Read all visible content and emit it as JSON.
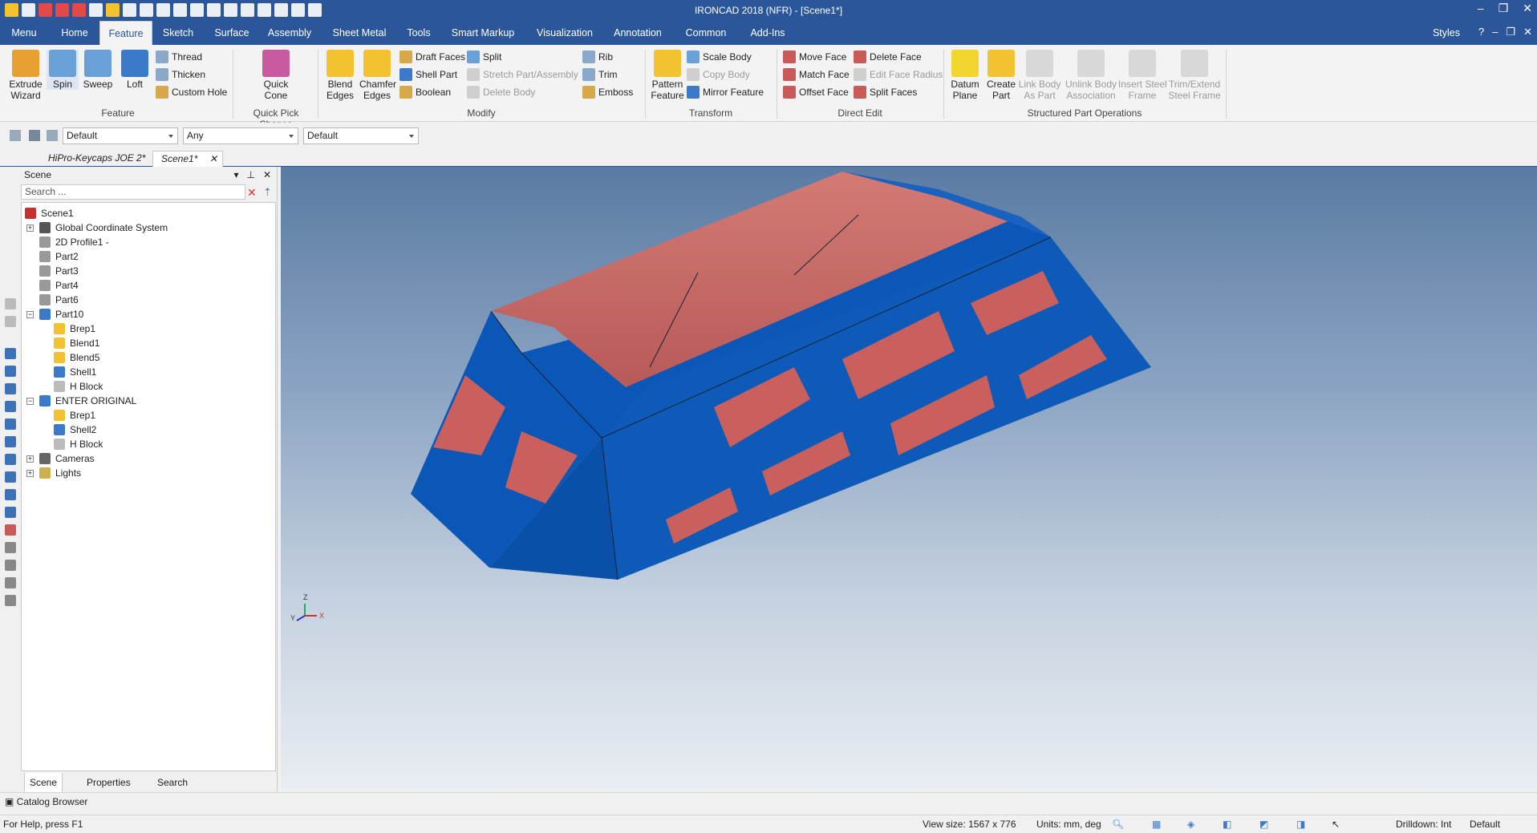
{
  "window": {
    "title": "IRONCAD 2018 (NFR) - [Scene1*]"
  },
  "menu_tabs": [
    "Menu",
    "Home",
    "Feature",
    "Sketch",
    "Surface",
    "Assembly",
    "Sheet Metal",
    "Tools",
    "Smart Markup",
    "Visualization",
    "Annotation",
    "Common",
    "Add-Ins"
  ],
  "active_tab": "Feature",
  "styles_label": "Styles",
  "ribbon": {
    "feature": {
      "extrude": "Extrude\nWizard",
      "spin": "Spin",
      "sweep": "Sweep",
      "loft": "Loft",
      "thread": "Thread",
      "thicken": "Thicken",
      "custom_hole": "Custom Hole",
      "group": "Feature"
    },
    "quick_pick": {
      "quick_cone": "Quick\nCone",
      "group": "Quick Pick Shapes"
    },
    "modify": {
      "blend_edges": "Blend\nEdges",
      "chamfer_edges": "Chamfer\nEdges",
      "draft_faces": "Draft Faces",
      "shell_part": "Shell Part",
      "boolean": "Boolean",
      "split": "Split",
      "stretch": "Stretch Part/Assembly",
      "delete_body": "Delete Body",
      "rib": "Rib",
      "trim": "Trim",
      "emboss": "Emboss",
      "group": "Modify"
    },
    "transform": {
      "pattern": "Pattern\nFeature",
      "scale_body": "Scale Body",
      "copy_body": "Copy Body",
      "mirror": "Mirror Feature",
      "group": "Transform"
    },
    "direct_edit": {
      "move_face": "Move Face",
      "match_face": "Match Face",
      "offset_face": "Offset Face",
      "delete_face": "Delete Face",
      "edit_face_radius": "Edit Face Radius",
      "split_faces": "Split Faces",
      "group": "Direct Edit"
    },
    "structured": {
      "datum_plane": "Datum\nPlane",
      "create_part": "Create\nPart",
      "link_body": "Link Body\nAs Part",
      "unlink_body": "Unlink Body\nAssociation",
      "insert_steel": "Insert Steel\nFrame",
      "trim_steel": "Trim/Extend\nSteel Frame",
      "group": "Structured Part Operations"
    }
  },
  "toolbar": {
    "combo1": "Default",
    "combo2": "Any",
    "combo3": "Default"
  },
  "doc_tabs": [
    {
      "label": "HiPro-Keycaps JOE 2*"
    },
    {
      "label": "Scene1*",
      "close": "✕"
    }
  ],
  "scene_panel": {
    "title": "Scene",
    "search_placeholder": "Search ...",
    "tree": [
      {
        "label": "Scene1",
        "depth": 0
      },
      {
        "label": "Global Coordinate System",
        "depth": 1
      },
      {
        "label": "2D Profile1 -",
        "depth": 1
      },
      {
        "label": "Part2",
        "depth": 1
      },
      {
        "label": "Part3",
        "depth": 1
      },
      {
        "label": "Part4",
        "depth": 1
      },
      {
        "label": "Part6",
        "depth": 1
      },
      {
        "label": "Part10",
        "depth": 1
      },
      {
        "label": "Brep1",
        "depth": 2
      },
      {
        "label": "Blend1",
        "depth": 2
      },
      {
        "label": "Blend5",
        "depth": 2
      },
      {
        "label": "Shell1",
        "depth": 2
      },
      {
        "label": "H Block",
        "depth": 2
      },
      {
        "label": "ENTER ORIGINAL",
        "depth": 1
      },
      {
        "label": "Brep1",
        "depth": 2
      },
      {
        "label": "Shell2",
        "depth": 2
      },
      {
        "label": "H Block",
        "depth": 2
      },
      {
        "label": "Cameras",
        "depth": 1
      },
      {
        "label": "Lights",
        "depth": 1
      }
    ],
    "tabs": [
      "Scene",
      "Properties",
      "Search"
    ]
  },
  "catalog_label": "Catalog Browser",
  "status": {
    "help": "For Help, press F1",
    "view_size": "View size: 1567 x 776",
    "units": "Units: mm, deg",
    "drilldown": "Drilldown: Int",
    "default": "Default"
  },
  "axis": {
    "z": "Z",
    "y": "Y",
    "x": "X"
  },
  "colors": {
    "title_bar": "#2b579a",
    "model_blue": "#0a55b5",
    "model_red": "#c9605e"
  }
}
